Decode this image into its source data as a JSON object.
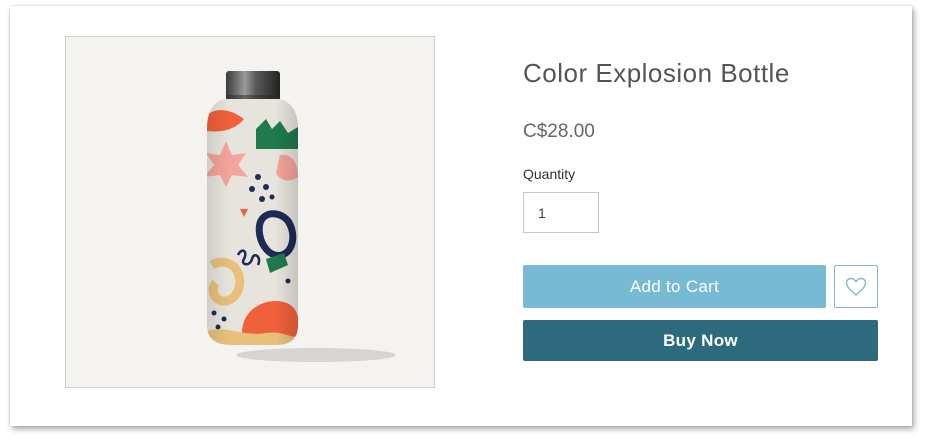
{
  "product": {
    "title": "Color Explosion Bottle",
    "price": "C$28.00",
    "quantity_label": "Quantity",
    "quantity_value": "1",
    "image_icon": "bottle-image"
  },
  "actions": {
    "add_to_cart_label": "Add to Cart",
    "buy_now_label": "Buy Now",
    "wishlist_icon": "heart-icon"
  },
  "colors": {
    "add_to_cart": "#78b9d3",
    "buy_now": "#2d6a7e",
    "title_text": "#555555",
    "image_background": "#f4f3ef"
  }
}
